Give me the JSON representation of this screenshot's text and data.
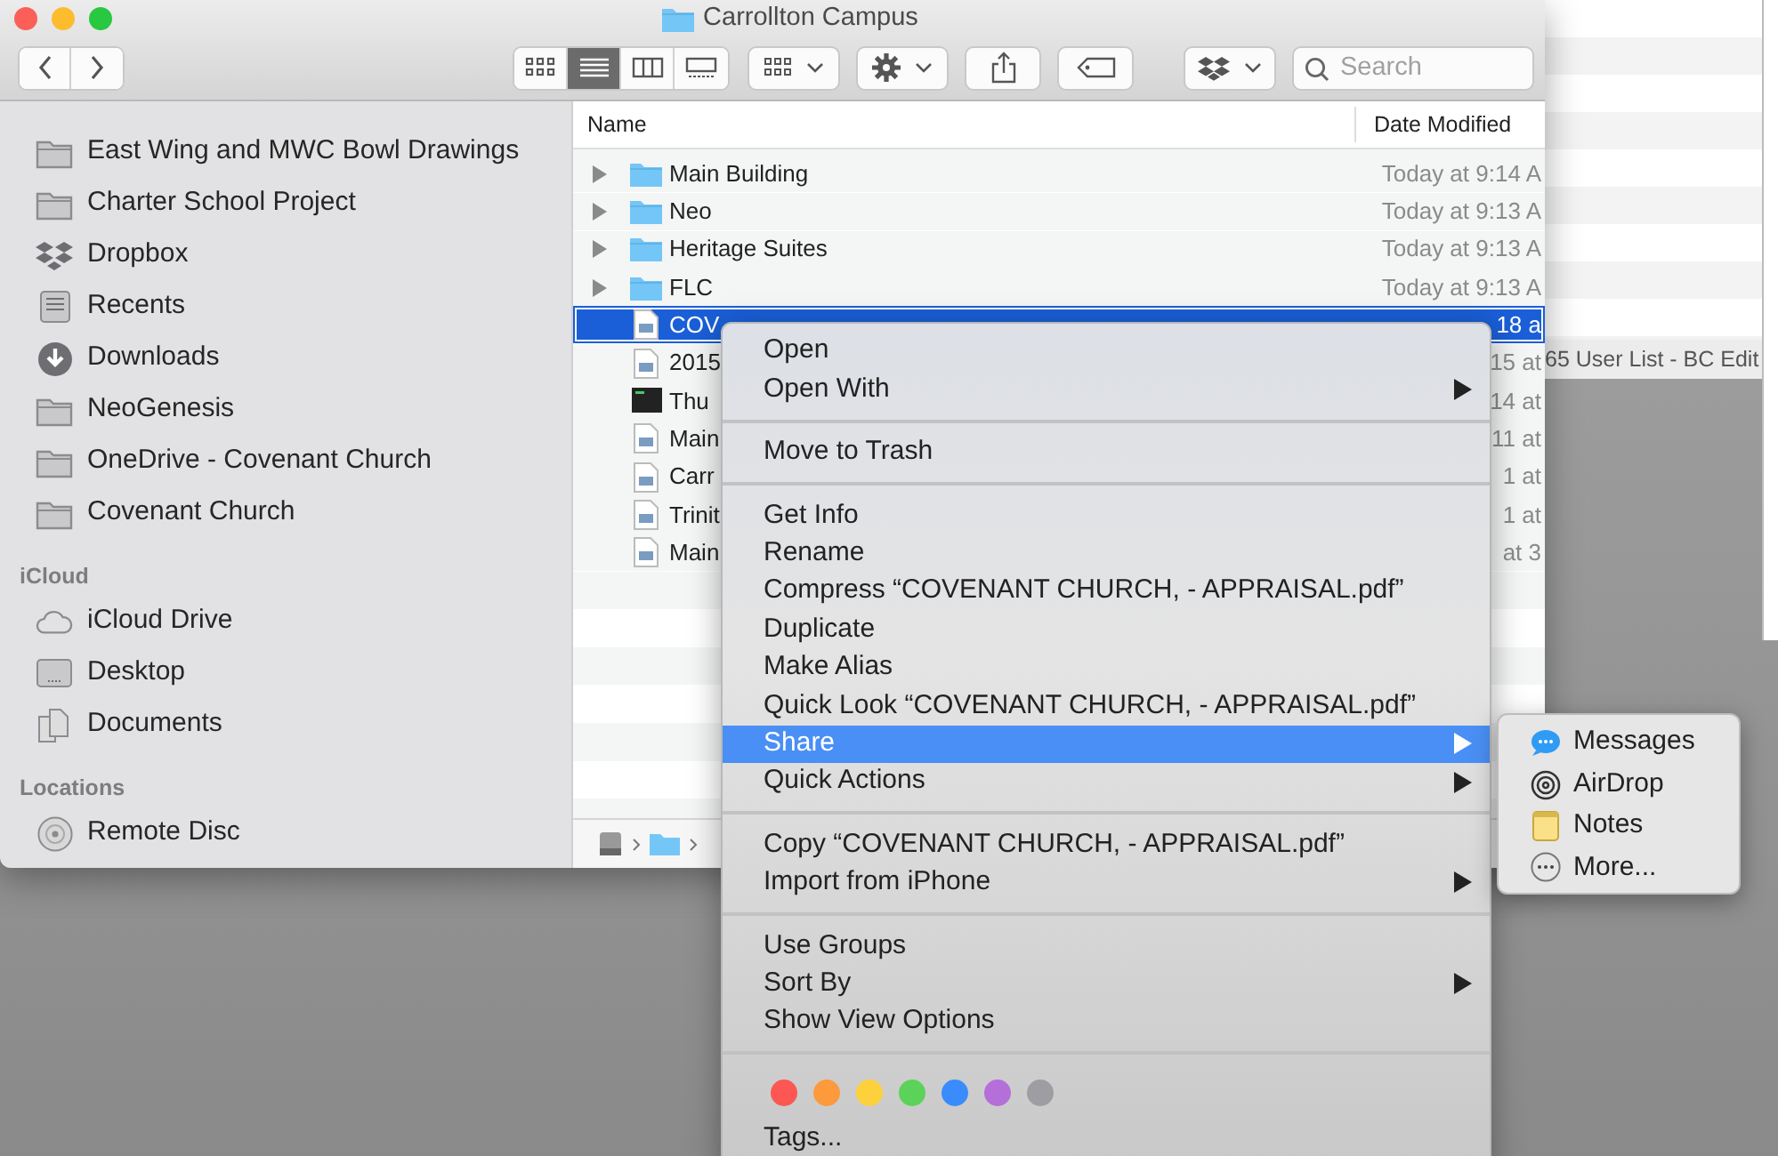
{
  "window": {
    "title": "Carrollton Campus"
  },
  "toolbar": {
    "view_modes": [
      {
        "selected": false
      },
      {
        "selected": true
      },
      {
        "selected": false
      },
      {
        "selected": false
      }
    ],
    "search": {
      "placeholder": "Search"
    }
  },
  "sidebar": {
    "sections": [
      {
        "items": [
          {
            "label": "East Wing and MWC Bowl Drawings",
            "kind": "folder"
          },
          {
            "label": "Charter School Project",
            "kind": "folder"
          },
          {
            "label": "Dropbox",
            "kind": "dropbox"
          },
          {
            "label": "Recents",
            "kind": "recents"
          },
          {
            "label": "Downloads",
            "kind": "downloads"
          },
          {
            "label": "NeoGenesis",
            "kind": "folder"
          },
          {
            "label": "OneDrive - Covenant Church",
            "kind": "folder"
          },
          {
            "label": "Covenant Church",
            "kind": "folder"
          }
        ]
      },
      {
        "heading": "iCloud",
        "items": [
          {
            "label": "iCloud Drive",
            "kind": "cloud"
          },
          {
            "label": "Desktop",
            "kind": "desktop"
          },
          {
            "label": "Documents",
            "kind": "documents"
          }
        ]
      },
      {
        "heading": "Locations",
        "items": [
          {
            "label": "Remote Disc",
            "kind": "disc"
          }
        ]
      }
    ]
  },
  "file_list": {
    "columns": [
      "Name",
      "Date Modified"
    ],
    "rows": [
      {
        "name": "Main Building",
        "date": "Today at 9:14 A",
        "kind": "folder",
        "expanded": false,
        "selected": false
      },
      {
        "name": "Neo",
        "date": "Today at 9:13 A",
        "kind": "folder",
        "expanded": false,
        "selected": false
      },
      {
        "name": "Heritage Suites",
        "date": "Today at 9:13 A",
        "kind": "folder",
        "expanded": false,
        "selected": false
      },
      {
        "name": "FLC",
        "date": "Today at 9:13 A",
        "kind": "folder",
        "expanded": false,
        "selected": false
      },
      {
        "name": "COV",
        "date": "18 a",
        "kind": "document",
        "selected": true
      },
      {
        "name": "2015",
        "date": "15 at",
        "kind": "document",
        "selected": false
      },
      {
        "name": "Thu",
        "date": "14 at",
        "kind": "thumbnail",
        "selected": false
      },
      {
        "name": "Main",
        "date": "11 at",
        "kind": "document",
        "selected": false
      },
      {
        "name": "Carr",
        "date": "1 at",
        "kind": "document",
        "selected": false
      },
      {
        "name": "Trinit",
        "date": "1 at",
        "kind": "document",
        "selected": false
      },
      {
        "name": "Main",
        "date": "at 3",
        "kind": "document",
        "selected": false
      }
    ]
  },
  "context_menu": {
    "groups": [
      {
        "items": [
          {
            "label": "Open",
            "has_submenu": false,
            "selected": false
          },
          {
            "label": "Open With",
            "has_submenu": true,
            "selected": false
          }
        ]
      },
      {
        "items": [
          {
            "label": "Move to Trash",
            "has_submenu": false,
            "selected": false
          }
        ]
      },
      {
        "items": [
          {
            "label": "Get Info",
            "has_submenu": false,
            "selected": false
          },
          {
            "label": "Rename",
            "has_submenu": false,
            "selected": false
          },
          {
            "label": "Compress “COVENANT CHURCH, - APPRAISAL.pdf”",
            "has_submenu": false,
            "selected": false
          },
          {
            "label": "Duplicate",
            "has_submenu": false,
            "selected": false
          },
          {
            "label": "Make Alias",
            "has_submenu": false,
            "selected": false
          },
          {
            "label": "Quick Look “COVENANT CHURCH, - APPRAISAL.pdf”",
            "has_submenu": false,
            "selected": false
          },
          {
            "label": "Share",
            "has_submenu": true,
            "selected": true
          },
          {
            "label": "Quick Actions",
            "has_submenu": true,
            "selected": false
          }
        ]
      },
      {
        "items": [
          {
            "label": "Copy “COVENANT CHURCH, - APPRAISAL.pdf”",
            "has_submenu": false,
            "selected": false
          },
          {
            "label": "Import from iPhone",
            "has_submenu": true,
            "selected": false
          }
        ]
      },
      {
        "items": [
          {
            "label": "Use Groups",
            "has_submenu": false,
            "selected": false
          },
          {
            "label": "Sort By",
            "has_submenu": true,
            "selected": false
          },
          {
            "label": "Show View Options",
            "has_submenu": false,
            "selected": false
          }
        ]
      }
    ],
    "tags": {
      "colors": [
        {
          "color": "#fc5753"
        },
        {
          "color": "#fd9a3c"
        },
        {
          "color": "#fdd13b"
        },
        {
          "color": "#5bd25a"
        },
        {
          "color": "#3a8cfc"
        },
        {
          "color": "#b46fd9"
        },
        {
          "color": "#9e9ea2"
        }
      ],
      "label": "Tags..."
    }
  },
  "share_submenu": {
    "items": [
      {
        "label": "Messages",
        "kind": "messages"
      },
      {
        "label": "AirDrop",
        "kind": "airdrop"
      },
      {
        "label": "Notes",
        "kind": "notes"
      },
      {
        "label": "More...",
        "kind": "more"
      }
    ]
  },
  "background_window": {
    "title": "65 User List - BC Edit"
  }
}
